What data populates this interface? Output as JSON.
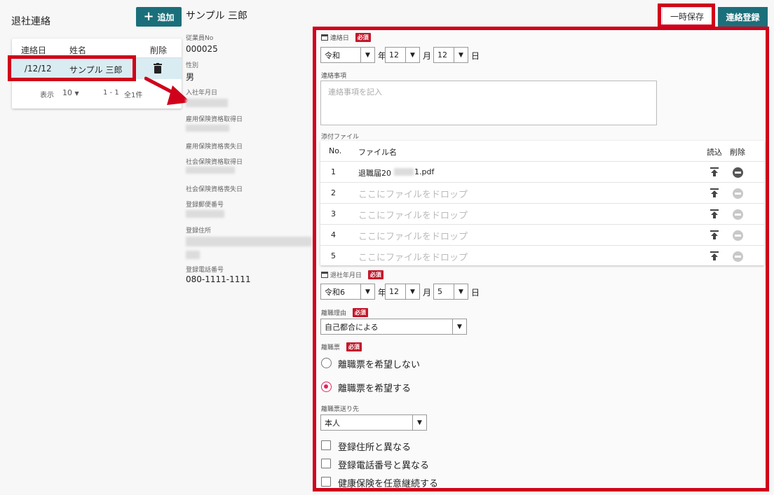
{
  "left": {
    "title": "退社連絡",
    "add_label": "追加",
    "columns": [
      "連絡日",
      "姓名",
      "削除"
    ],
    "row": {
      "date": "/12/12",
      "name": "サンプル 三郎"
    },
    "footer": {
      "show_label": "表示",
      "page_size": "10",
      "range": "1 - 1",
      "total": "全1件"
    }
  },
  "employee": {
    "name": "サンプル 三郎",
    "fields": [
      {
        "label": "従業員No",
        "value": "000025"
      },
      {
        "label": "性別",
        "value": "男"
      },
      {
        "label": "入社年月日",
        "value": ""
      },
      {
        "label": "雇用保険資格取得日",
        "value": ""
      },
      {
        "label": "雇用保険資格喪失日",
        "value": ""
      },
      {
        "label": "社会保険資格取得日",
        "value": ""
      },
      {
        "label": "社会保険資格喪失日",
        "value": ""
      },
      {
        "label": "登録郵便番号",
        "value": ""
      },
      {
        "label": "登録住所",
        "value": ""
      },
      {
        "label": "登録電話番号",
        "value": "080-1111-1111"
      }
    ]
  },
  "actions": {
    "temp_save": "一時保存",
    "register": "連絡登録"
  },
  "form": {
    "required": "必須",
    "contact_date": {
      "label": "連絡日",
      "era": "令和",
      "month": "12",
      "day": "12",
      "year_unit": "年",
      "month_unit": "月",
      "day_unit": "日"
    },
    "notes": {
      "label": "連絡事項",
      "placeholder": "連絡事項を記入"
    },
    "attachments": {
      "label": "添付ファイル",
      "columns": {
        "no": "No.",
        "file": "ファイル名",
        "read": "読込",
        "delete": "削除"
      },
      "rows": [
        {
          "no": "1",
          "file": "退職届20",
          "file_suffix": "1.pdf",
          "filled": true
        },
        {
          "no": "2",
          "file": "ここにファイルをドロップ",
          "filled": false
        },
        {
          "no": "3",
          "file": "ここにファイルをドロップ",
          "filled": false
        },
        {
          "no": "4",
          "file": "ここにファイルをドロップ",
          "filled": false
        },
        {
          "no": "5",
          "file": "ここにファイルをドロップ",
          "filled": false
        }
      ]
    },
    "leave_date": {
      "label": "退社年月日",
      "era": "令和6",
      "month": "12",
      "day": "5",
      "year_unit": "年",
      "month_unit": "月",
      "day_unit": "日"
    },
    "reason": {
      "label": "離職理由",
      "value": "自己都合による"
    },
    "separation_slip": {
      "label": "離職票",
      "options": [
        "離職票を希望しない",
        "離職票を希望する"
      ],
      "selected_index": 1
    },
    "slip_destination": {
      "label": "離職票送り先",
      "value": "本人"
    },
    "checkboxes": [
      "登録住所と異なる",
      "登録電話番号と異なる",
      "健康保険を任意継続する"
    ]
  },
  "colors": {
    "accent": "#1b6f7a",
    "highlight": "#d0021b",
    "required": "#c2182b",
    "radio_on": "#e0245e",
    "row_selected": "#d9ecf2"
  },
  "icons": [
    "plus-icon",
    "trash-icon",
    "calendar-icon",
    "upload-icon",
    "remove-circle-icon",
    "dropdown-arrow-icon"
  ]
}
